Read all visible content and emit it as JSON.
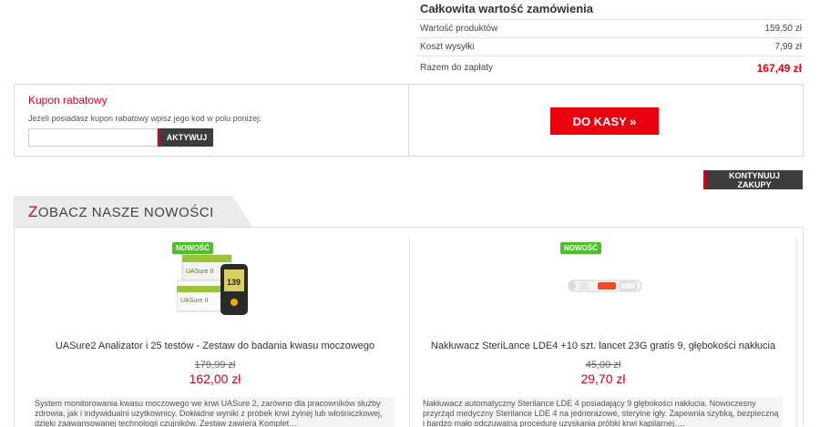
{
  "summary": {
    "title": "Całkowita wartość zamówienia",
    "products_label": "Wartość produktów",
    "products_value": "159,50 zł",
    "shipping_label": "Koszt wysyłki",
    "shipping_value": "7,99 zł",
    "total_label": "Razem do zapłaty",
    "total_value": "167,49 zł"
  },
  "coupon": {
    "title": "Kupon rabatowy",
    "description": "Jeżeli posiadasz kupon rabatowy wpisz jego kod w polu poniżej:",
    "input_value": "",
    "button_label": "AKTYWUJ"
  },
  "checkout_label": "DO KASY »",
  "continue_label": "KONTYNUUJ ZAKUPY",
  "section": {
    "title_first": "Z",
    "title_rest": "OBACZ NASZE NOWOŚCI"
  },
  "products": [
    {
      "badge": "NOWOŚĆ",
      "image_brand": "UASure II",
      "image_display": "139",
      "name": "UASure2 Analizator i 25 testów - Zestaw do badania kwasu moczowego",
      "old_price": "179,99 zł",
      "new_price": "162,00 zł",
      "description": "System monitorowania kwasu moczowego we krwi UASure 2, zarówno dla pracowników służby zdrowia, jak i indywidualni użytkownicy. Dokładne wyniki z próbek krwi żylnej lub włośniczkowej, dzięki zaawansowanej technologii czujników. Zestaw zawiera Komplet…"
    },
    {
      "badge": "NOWOŚĆ",
      "name": "Nakłuwacz SteriLance LDE4 +10 szt. lancet 23G gratis 9, głębokości nakłucia",
      "old_price": "45,00 zł",
      "new_price": "29,70 zł",
      "description": "Nakłuwacz automatyczny Sterilance LDE 4 posiadający 9 głębokości nakłucia. Nowoczesny przyrząd medyczny Sterilance LDE 4  na jednorazowe, sterylne igły. Zapewnia szybką, bezpieczną i bardzo mało odczuwalną procedurę uzyskania próbki krwi kapilarnej…."
    }
  ],
  "colors": {
    "accent": "#e8000f",
    "badge": "#4ec02c",
    "dark_button": "#3c3c3c"
  }
}
